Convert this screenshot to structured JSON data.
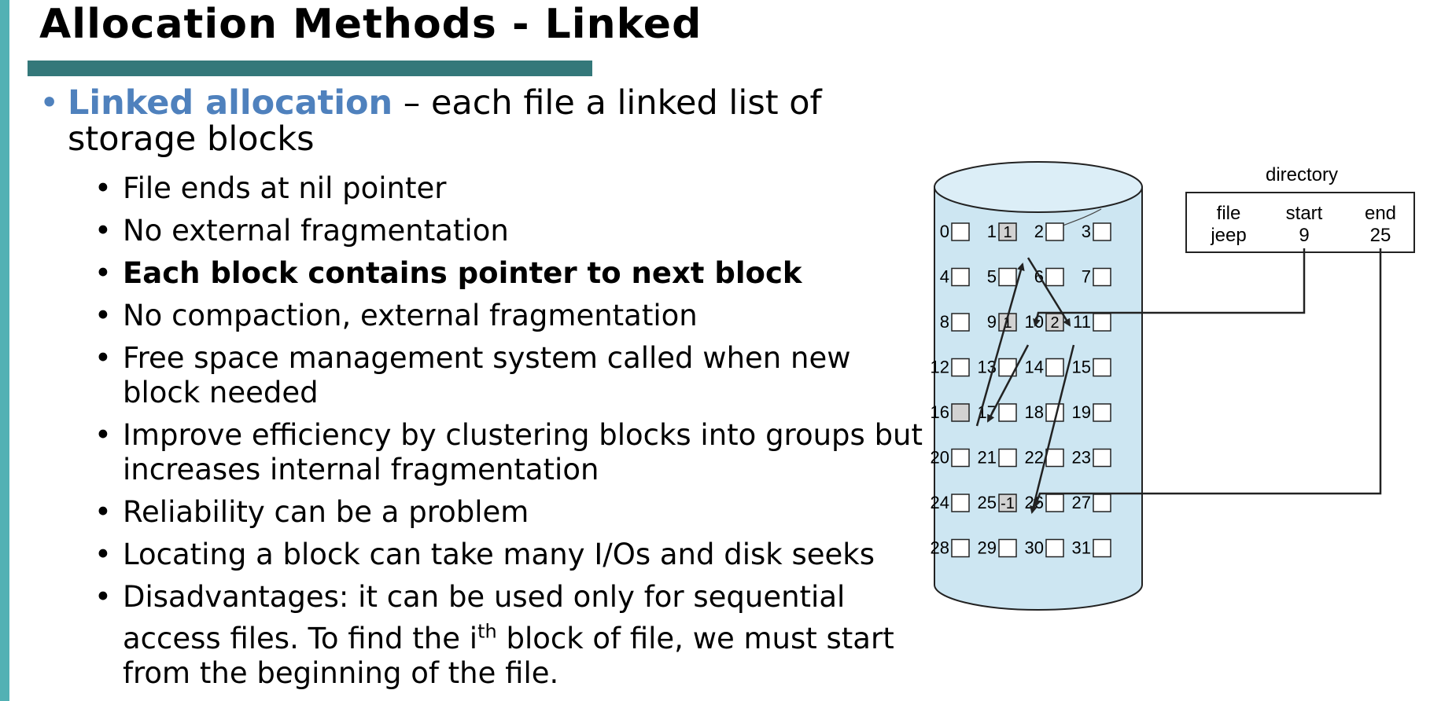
{
  "slide": {
    "title": "Allocation Methods - Linked",
    "bullet": {
      "term": "Linked allocation",
      "rest_line1": " – each file a linked list of",
      "rest_line2": "storage blocks"
    },
    "sub_bullets": [
      {
        "text": "File ends at nil pointer",
        "bold": false
      },
      {
        "text": "No external fragmentation",
        "bold": false
      },
      {
        "text": "Each block contains pointer to next block",
        "bold": true
      },
      {
        "text": "No compaction, external fragmentation",
        "bold": false
      },
      {
        "line1": "Free space management system called when new",
        "line2": "block needed"
      },
      {
        "line1": "Improve efficiency by clustering blocks into groups but",
        "line2": "increases internal fragmentation"
      },
      {
        "text": "Reliability can be a problem",
        "bold": false
      },
      {
        "text": "Locating a block can take many I/Os and disk seeks",
        "bold": false
      },
      {
        "line1_a": "Disadvantages: it can be used only for sequential",
        "line2_a": "access files. To find the i",
        "line2_sup": "th",
        "line2_b": " block of file, we must start",
        "line3": "from the beginning of the file."
      }
    ]
  },
  "diagram": {
    "directory_label": "directory",
    "columns": [
      "file",
      "start",
      "end"
    ],
    "row": [
      "jeep",
      "9",
      "25"
    ],
    "blocks": [
      "0",
      "1",
      "2",
      "3",
      "4",
      "5",
      "6",
      "7",
      "8",
      "9",
      "10",
      "11",
      "12",
      "13",
      "14",
      "15",
      "16",
      "17",
      "18",
      "19",
      "20",
      "21",
      "22",
      "23",
      "24",
      "25",
      "26",
      "27",
      "28",
      "29",
      "30",
      "31"
    ],
    "filled_blocks": [
      {
        "block": 1,
        "value": "1"
      },
      {
        "block": 9,
        "value": "1"
      },
      {
        "block": 10,
        "value": "2"
      },
      {
        "block": 16,
        "value": ""
      },
      {
        "block": 25,
        "value": "-1"
      }
    ]
  }
}
